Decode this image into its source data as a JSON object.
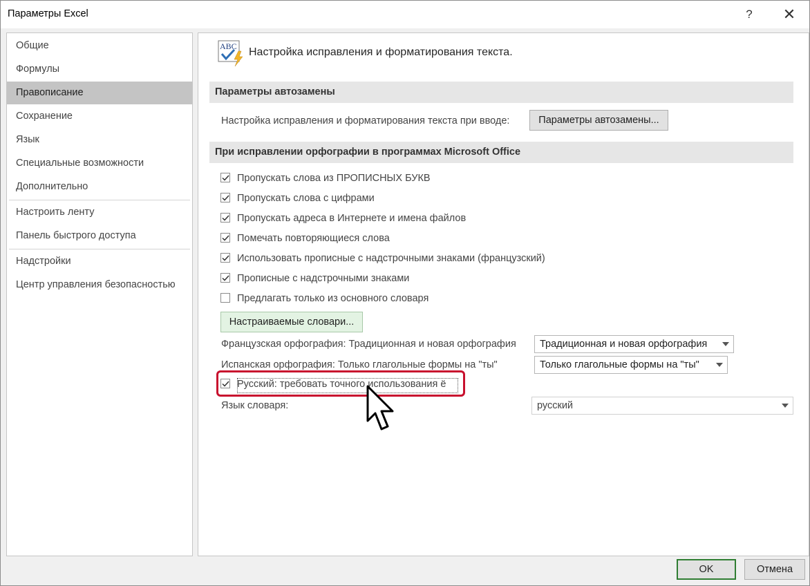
{
  "window": {
    "title": "Параметры Excel",
    "help_glyph": "?",
    "close_glyph": "✕"
  },
  "nav": {
    "items": [
      {
        "label": "Общие"
      },
      {
        "label": "Формулы"
      },
      {
        "label": "Правописание",
        "selected": true
      },
      {
        "label": "Сохранение"
      },
      {
        "label": "Язык"
      },
      {
        "label": "Специальные возможности"
      },
      {
        "label": "Дополнительно"
      },
      {
        "label": "Настроить ленту"
      },
      {
        "label": "Панель быстрого доступа"
      },
      {
        "label": "Надстройки"
      },
      {
        "label": "Центр управления безопасностью"
      }
    ]
  },
  "content": {
    "header": "Настройка исправления и форматирования текста.",
    "icon_text": "ABC",
    "autocorrect": {
      "section_title": "Параметры автозамены",
      "label": "Настройка исправления и форматирования текста при вводе:",
      "button": "Параметры автозамены..."
    },
    "spelling": {
      "section_title": "При исправлении орфографии в программах Microsoft Office",
      "checkboxes": [
        {
          "label": "Пропускать слова из ПРОПИСНЫХ БУКВ",
          "checked": true
        },
        {
          "label": "Пропускать слова с цифрами",
          "checked": true
        },
        {
          "label": "Пропускать адреса в Интернете и имена файлов",
          "checked": true
        },
        {
          "label": "Помечать повторяющиеся слова",
          "checked": true
        },
        {
          "label": "Использовать прописные с надстрочными знаками (французский)",
          "checked": true
        },
        {
          "label": "Прописные с надстрочными знаками",
          "checked": true
        },
        {
          "label": "Предлагать только из основного словаря",
          "checked": false
        }
      ],
      "custom_dict_button": "Настраиваемые словари...",
      "french_label": "Французская орфография: Традиционная и новая орфография",
      "french_value": "Традиционная и новая орфография",
      "spanish_label": "Испанская орфография: Только глагольные формы на \"ты\"",
      "spanish_value": "Только глагольные формы на \"ты\"",
      "russian_checkbox": {
        "label": "Русский: требовать точного использования ё",
        "checked": true
      },
      "dictionary_label": "Язык словаря:",
      "dictionary_value": "русский"
    }
  },
  "footer": {
    "ok": "OK",
    "cancel": "Отмена"
  },
  "colors": {
    "highlight": "#c8102e",
    "selected_nav": "#c4c4c4",
    "section_bg": "#e6e6e6",
    "ok_border": "#2f7d32"
  }
}
